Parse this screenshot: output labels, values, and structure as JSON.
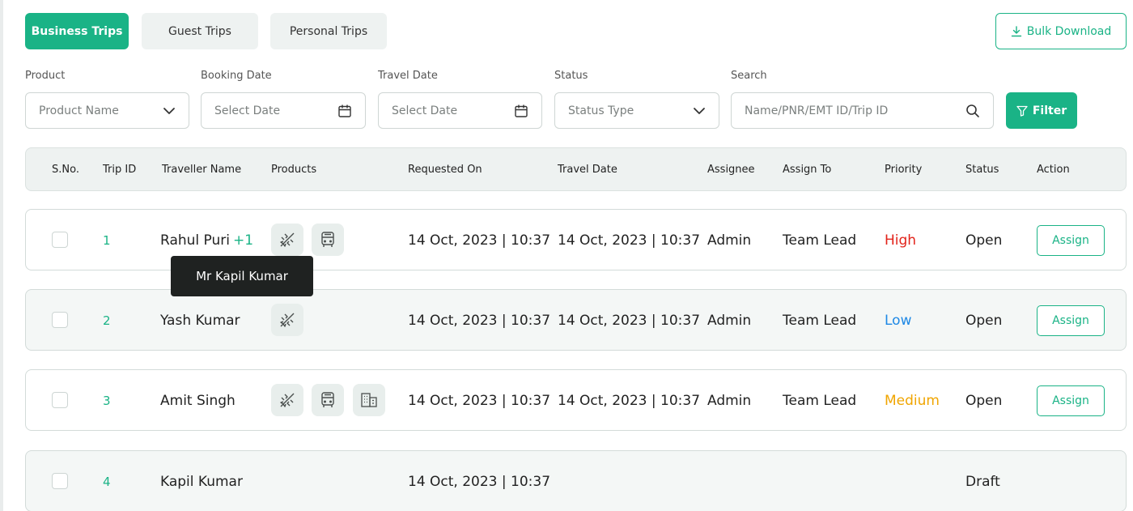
{
  "tabs": {
    "business": "Business Trips",
    "guest": "Guest Trips",
    "personal": "Personal Trips"
  },
  "bulk_download": "Bulk Download",
  "filters": {
    "product_label": "Product",
    "product_placeholder": "Product Name",
    "booking_label": "Booking Date",
    "booking_placeholder": "Select Date",
    "travel_label": "Travel Date",
    "travel_placeholder": "Select Date",
    "status_label": "Status",
    "status_placeholder": "Status Type",
    "search_label": "Search",
    "search_placeholder": "Name/PNR/EMT ID/Trip ID",
    "filter_button": "Filter"
  },
  "columns": {
    "sno": "S.No.",
    "trip_id": "Trip ID",
    "traveller": "Traveller Name",
    "products": "Products",
    "requested": "Requested On",
    "travel_date": "Travel Date",
    "assignee": "Assignee",
    "assign_to": "Assign To",
    "priority": "Priority",
    "status": "Status",
    "action": "Action"
  },
  "rows": [
    {
      "trip_id": "1",
      "traveller": "Rahul Puri",
      "extra": "+1",
      "products": [
        "flight-icon",
        "bus-icon"
      ],
      "requested": "14 Oct, 2023 | 10:37",
      "travel_date": "14 Oct, 2023 | 10:37",
      "assignee": "Admin",
      "assign_to": "Team Lead",
      "priority": "High",
      "status": "Open",
      "action": "Assign"
    },
    {
      "trip_id": "2",
      "traveller": "Yash Kumar",
      "products": [
        "flight-icon"
      ],
      "requested": "14 Oct, 2023 | 10:37",
      "travel_date": "14 Oct, 2023 | 10:37",
      "assignee": "Admin",
      "assign_to": "Team Lead",
      "priority": "Low",
      "status": "Open",
      "action": "Assign"
    },
    {
      "trip_id": "3",
      "traveller": "Amit Singh",
      "products": [
        "flight-icon",
        "bus-icon",
        "hotel-icon"
      ],
      "requested": "14 Oct, 2023 | 10:37",
      "travel_date": "14 Oct, 2023 | 10:37",
      "assignee": "Admin",
      "assign_to": "Team Lead",
      "priority": "Medium",
      "status": "Open",
      "action": "Assign"
    },
    {
      "trip_id": "4",
      "traveller": "Kapil Kumar",
      "products": [],
      "requested": "14 Oct, 2023 | 10:37",
      "travel_date": "",
      "assignee": "",
      "assign_to": "",
      "priority": "",
      "status": "Draft",
      "action": ""
    }
  ],
  "tooltip": "Mr Kapil Kumar",
  "colors": {
    "accent": "#1ab386",
    "priority_high": "#e2231a",
    "priority_low": "#1e88e5",
    "priority_medium": "#f0a500"
  }
}
